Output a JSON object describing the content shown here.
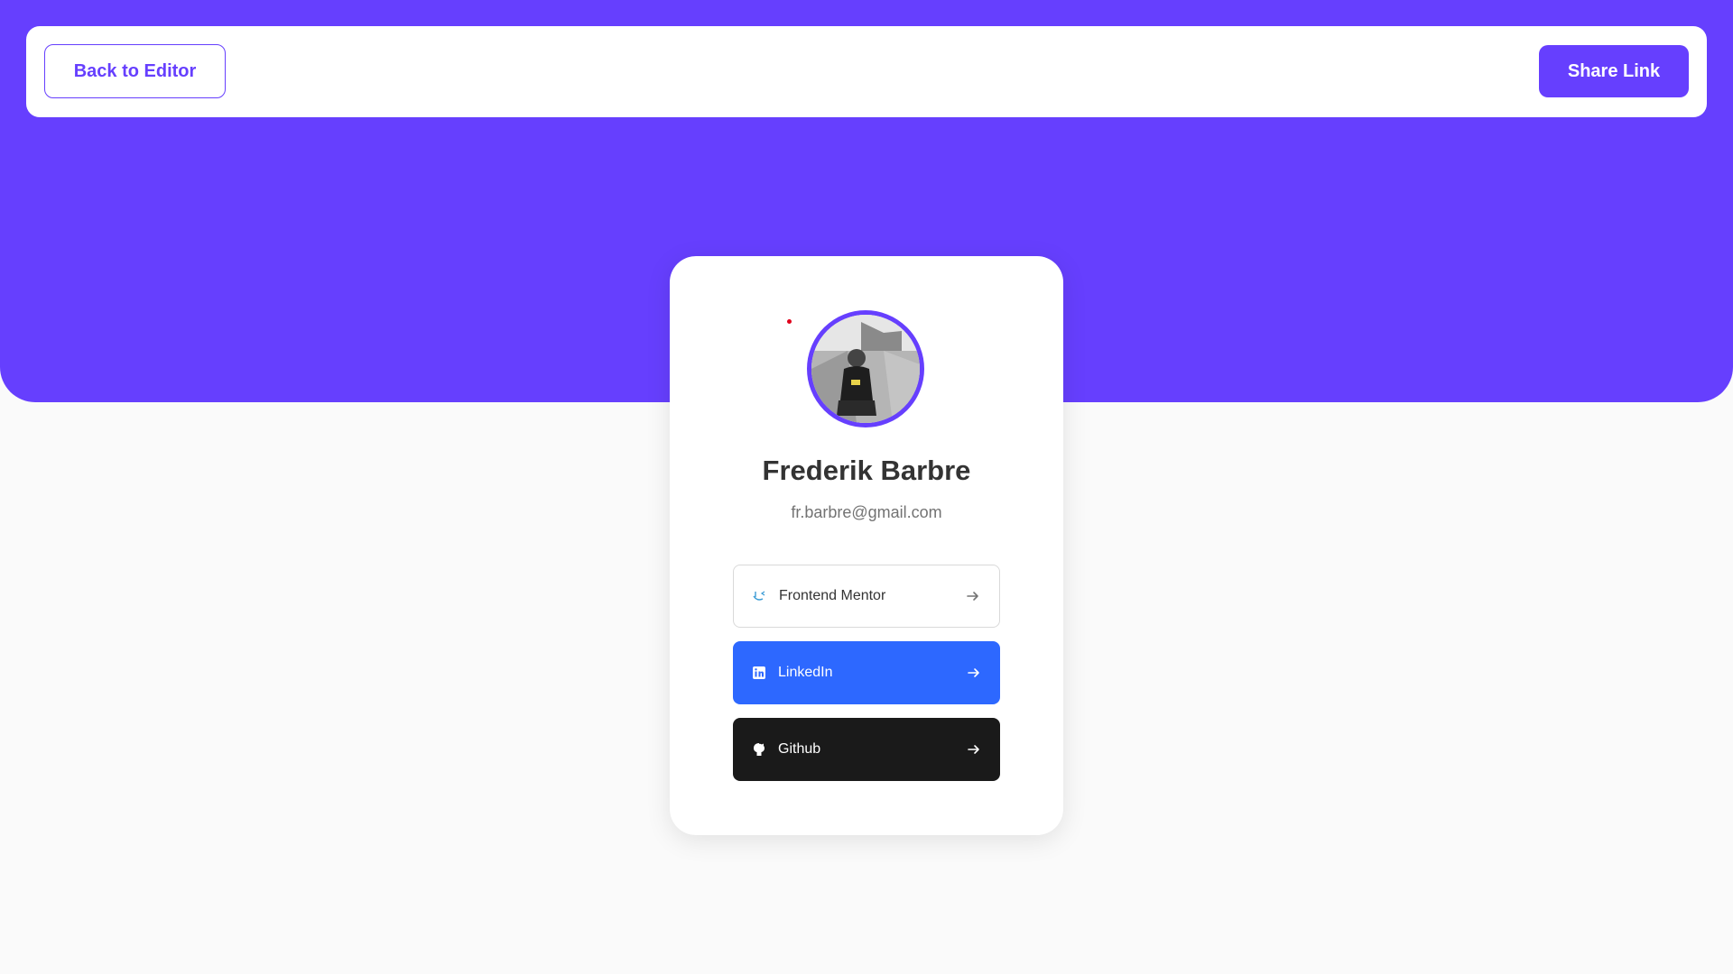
{
  "colors": {
    "accent": "#663ffe",
    "background": "#fafafa",
    "linkedin": "#2d68ff",
    "github": "#1a1a1a"
  },
  "nav": {
    "back_label": "Back to Editor",
    "share_label": "Share Link"
  },
  "profile": {
    "name": "Frederik Barbre",
    "email": "fr.barbre@gmail.com"
  },
  "links": [
    {
      "label": "Frontend Mentor",
      "icon": "frontend-mentor-icon"
    },
    {
      "label": "LinkedIn",
      "icon": "linkedin-icon"
    },
    {
      "label": "Github",
      "icon": "github-icon"
    }
  ]
}
